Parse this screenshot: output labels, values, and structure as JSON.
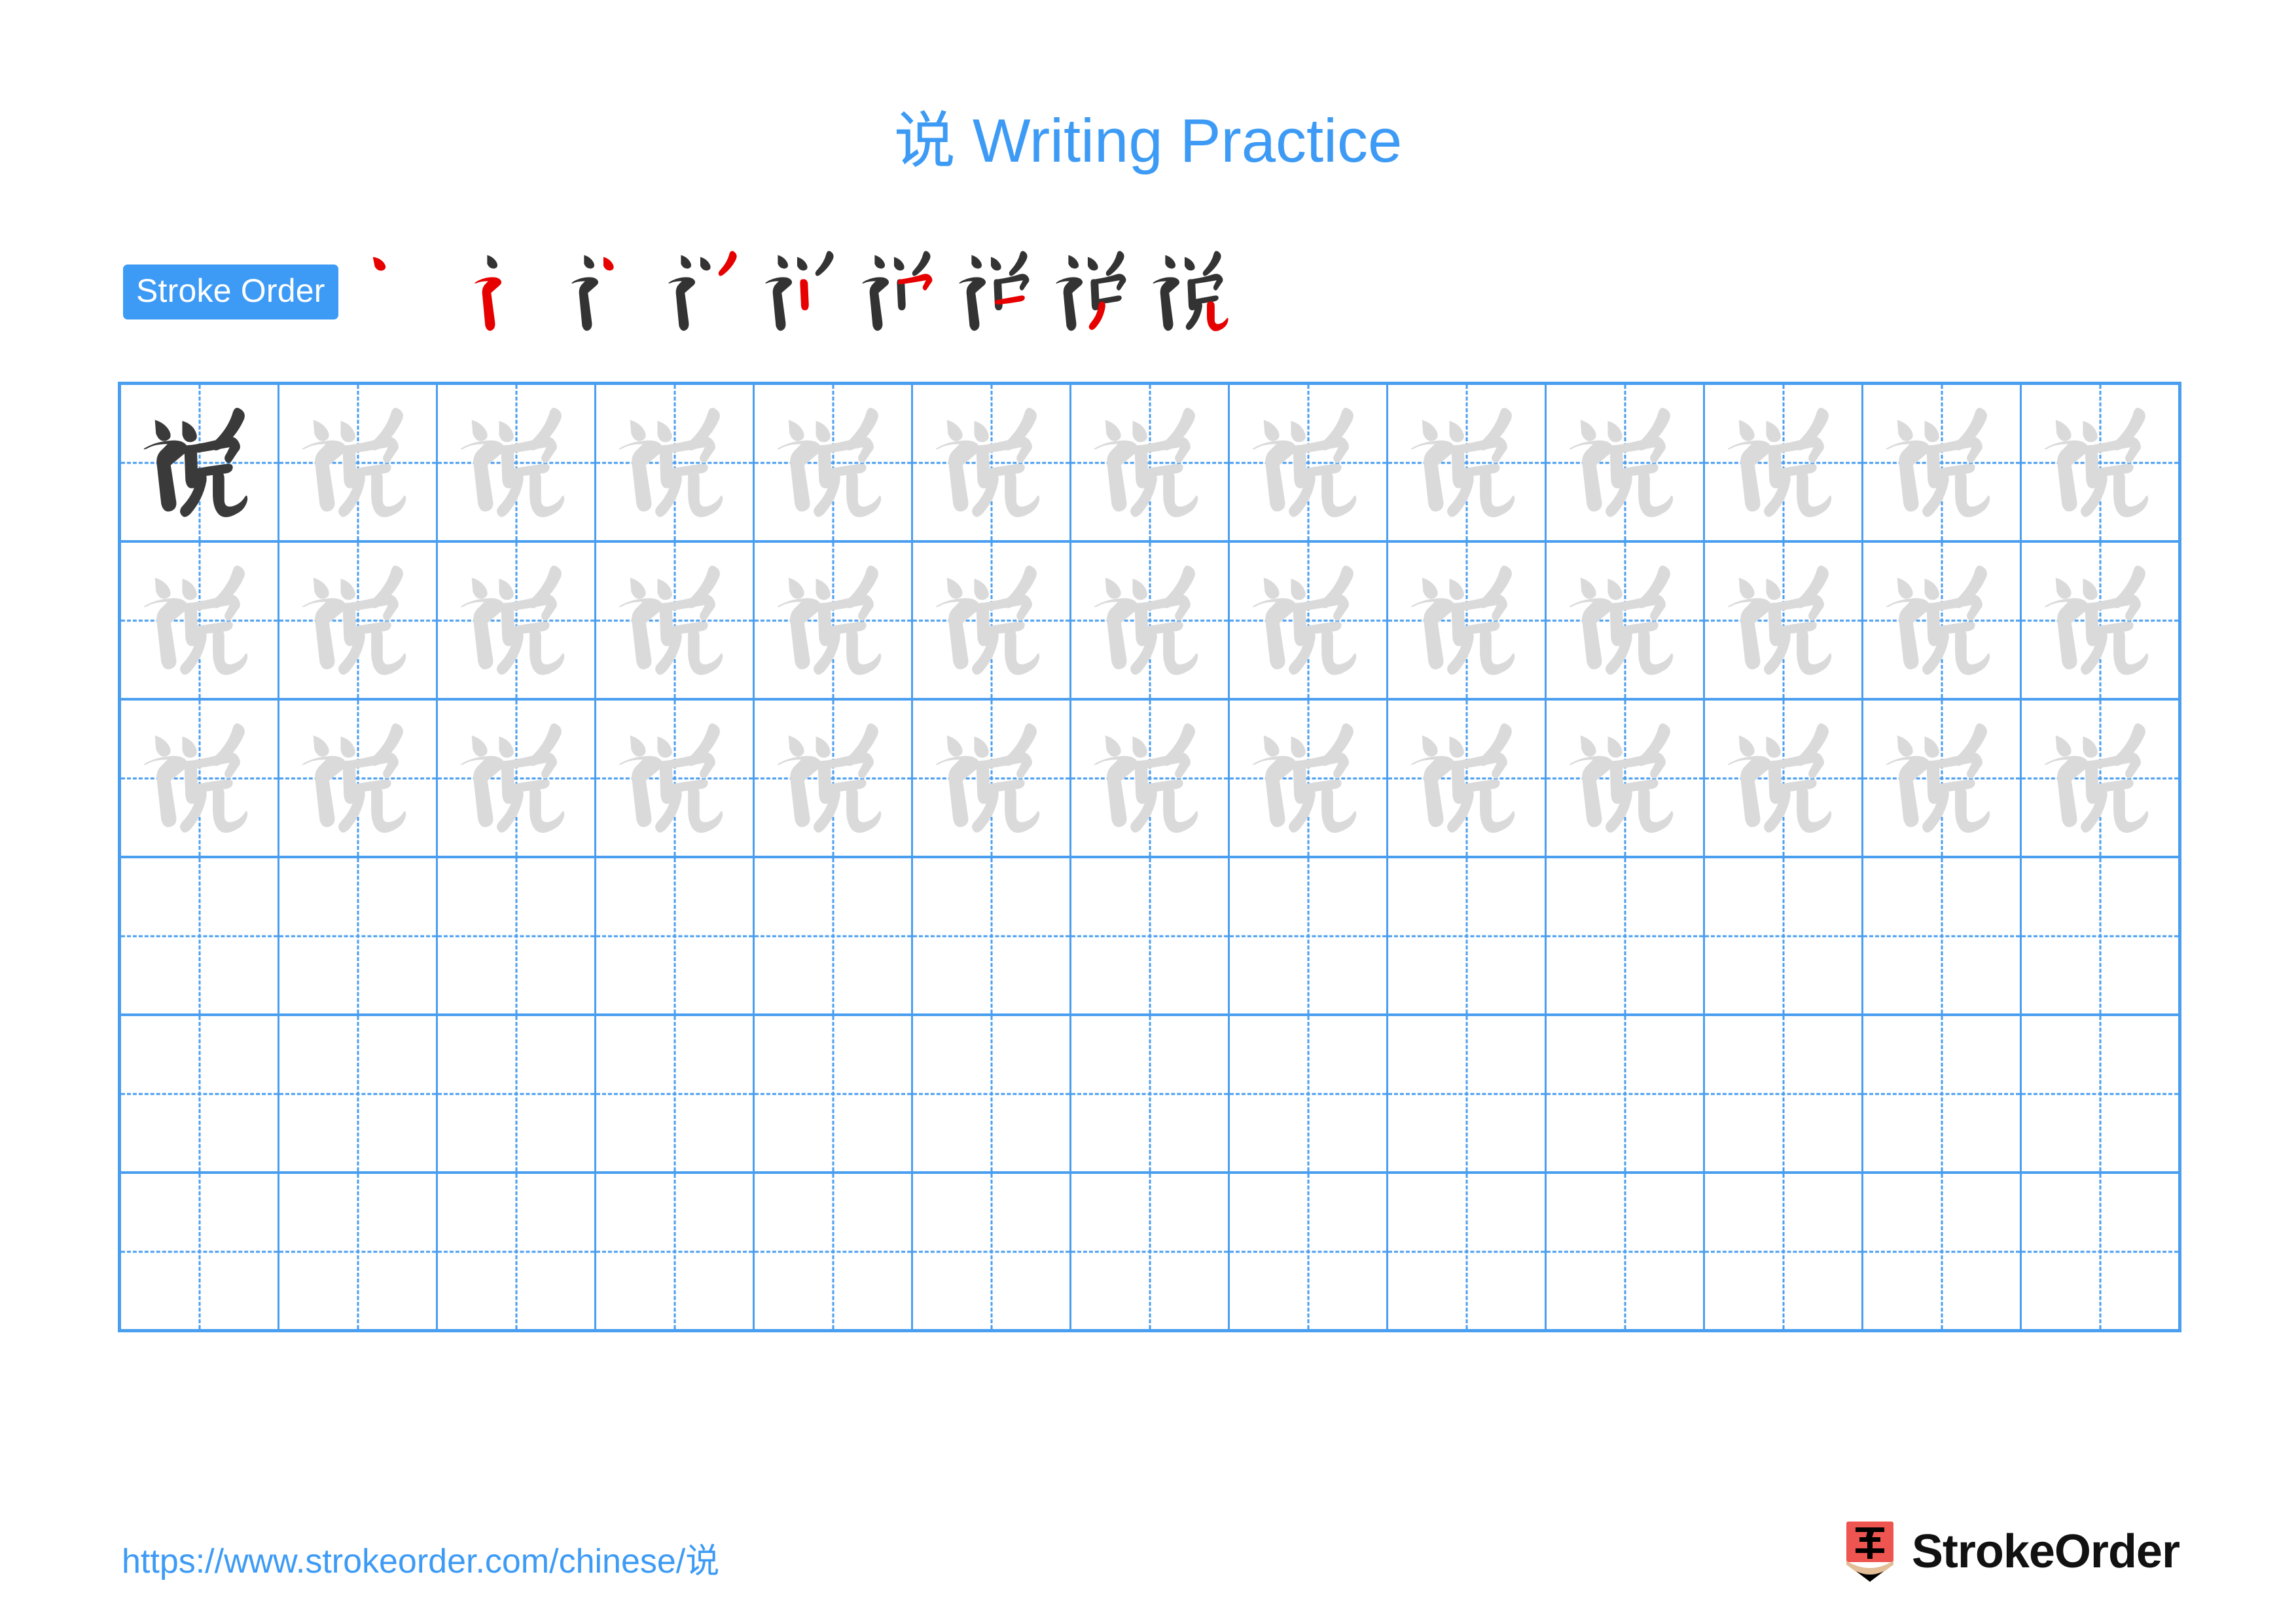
{
  "document": {
    "character": "说",
    "title": "说 Writing Practice",
    "background_color": "#ffffff",
    "accent_color": "#3d9bf5",
    "grid_line_color": "#4a9ef0",
    "ink_dark_color": "#3a3a3a",
    "ink_light_color": "#dadada",
    "stroke_new_color": "#e60000",
    "stroke_old_color": "#333333"
  },
  "stroke_order": {
    "badge_label": "Stroke Order",
    "total_strokes": 9,
    "steps": [
      1,
      2,
      3,
      4,
      5,
      6,
      7,
      8,
      9
    ]
  },
  "practice_grid": {
    "columns": 13,
    "rows": 6,
    "filled_rows": 3,
    "first_cell_is_dark": true,
    "rows_data": [
      [
        "说",
        "说",
        "说",
        "说",
        "说",
        "说",
        "说",
        "说",
        "说",
        "说",
        "说",
        "说",
        "说"
      ],
      [
        "说",
        "说",
        "说",
        "说",
        "说",
        "说",
        "说",
        "说",
        "说",
        "说",
        "说",
        "说",
        "说"
      ],
      [
        "说",
        "说",
        "说",
        "说",
        "说",
        "说",
        "说",
        "说",
        "说",
        "说",
        "说",
        "说",
        "说"
      ],
      [
        "",
        "",
        "",
        "",
        "",
        "",
        "",
        "",
        "",
        "",
        "",
        "",
        ""
      ],
      [
        "",
        "",
        "",
        "",
        "",
        "",
        "",
        "",
        "",
        "",
        "",
        "",
        ""
      ],
      [
        "",
        "",
        "",
        "",
        "",
        "",
        "",
        "",
        "",
        "",
        "",
        "",
        ""
      ]
    ]
  },
  "footer": {
    "url": "https://www.strokeorder.com/chinese/说",
    "brand_name": "StrokeOrder",
    "logo_character": "字",
    "logo_body_color": "#ee5450",
    "logo_wood_color": "#e3bd96",
    "logo_tip_color": "#000000"
  }
}
